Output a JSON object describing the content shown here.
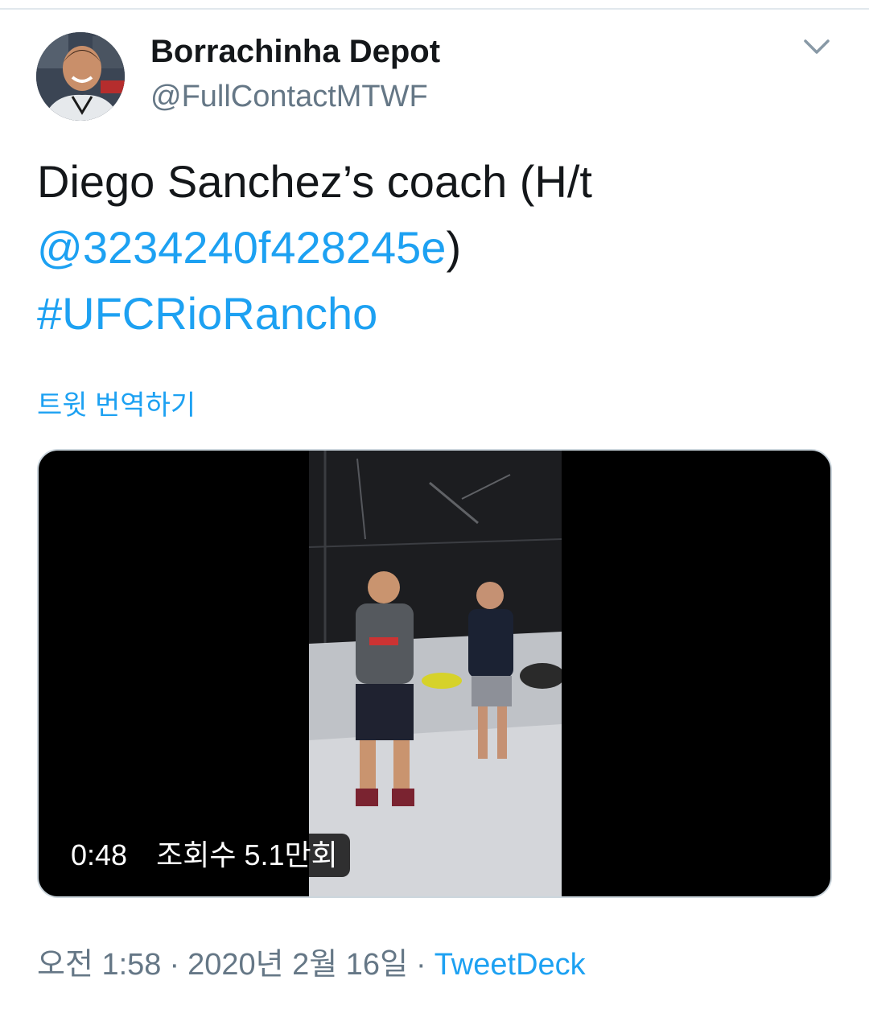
{
  "header": {
    "display_name": "Borrachinha Depot",
    "handle": "@FullContactMTWF",
    "avatar_icon": "user-avatar-icon",
    "menu_icon": "chevron-down-icon"
  },
  "tweet": {
    "text_line1": "Diego Sanchez’s coach (H/t",
    "mention": "@3234240f428245e",
    "mention_suffix": ")",
    "hashtag": "#UFCRioRancho",
    "translate_label": "트윗 번역하기"
  },
  "media": {
    "duration": "0:48",
    "views": "조회수 5.1만회"
  },
  "meta": {
    "time": "오전 1:58",
    "separator": "·",
    "date": "2020년 2월 16일",
    "source": "TweetDeck"
  },
  "colors": {
    "link": "#1da1f2",
    "text": "#14171a",
    "secondary": "#657786",
    "border": "#ccd6dd"
  }
}
